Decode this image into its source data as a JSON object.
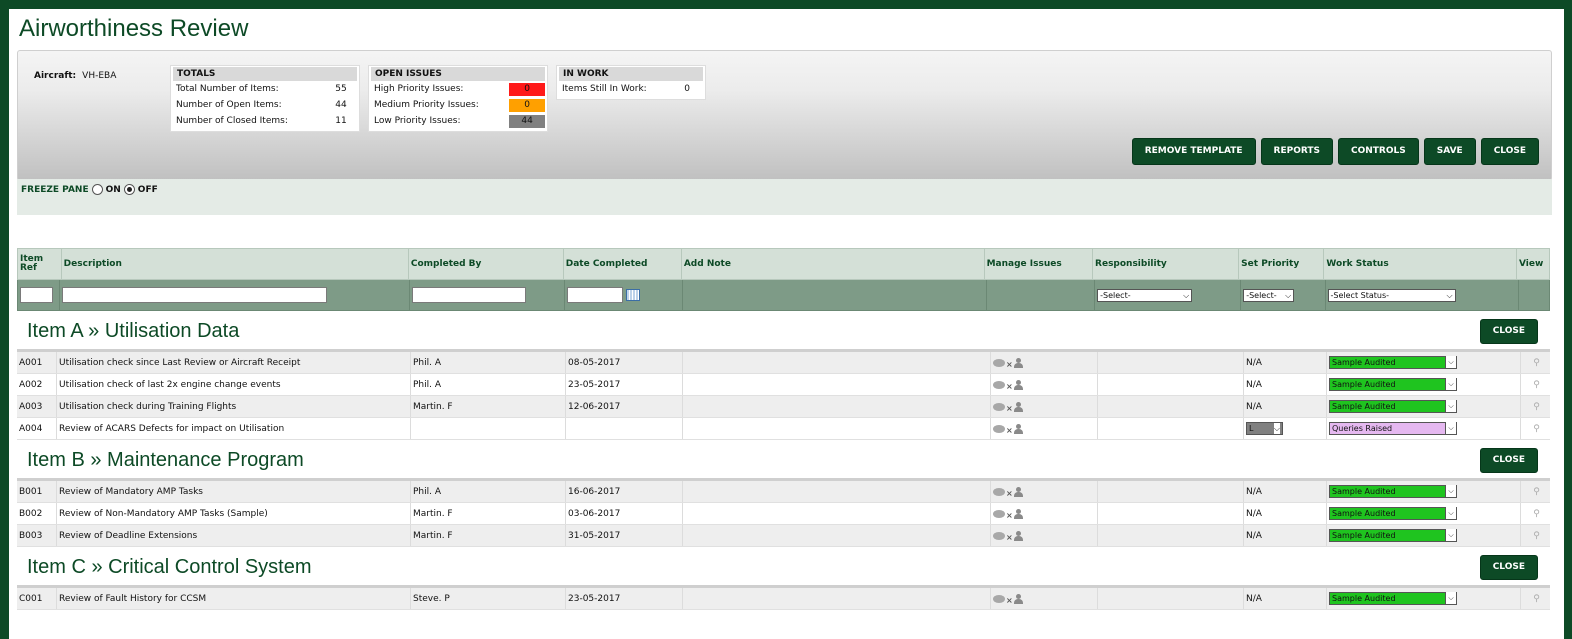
{
  "app": {
    "title": "Airworthiness Review"
  },
  "aircraft": {
    "label": "Aircraft:",
    "value": "VH-EBA"
  },
  "totals": {
    "heading": "TOTALS",
    "rows": [
      {
        "label": "Total Number of Items:",
        "value": "55"
      },
      {
        "label": "Number of Open Items:",
        "value": "44"
      },
      {
        "label": "Number of Closed Items:",
        "value": "11"
      }
    ]
  },
  "open_issues": {
    "heading": "OPEN ISSUES",
    "rows": [
      {
        "label": "High Priority Issues:",
        "value": "0",
        "color": "#ff1a1a"
      },
      {
        "label": "Medium Priority Issues:",
        "value": "0",
        "color": "#ffa000"
      },
      {
        "label": "Low Priority Issues:",
        "value": "44",
        "color": "#808080"
      }
    ]
  },
  "in_work": {
    "heading": "IN WORK",
    "rows": [
      {
        "label": "Items Still In Work:",
        "value": "0"
      }
    ]
  },
  "toolbar": {
    "remove_template": "REMOVE TEMPLATE",
    "reports": "REPORTS",
    "controls": "CONTROLS",
    "save": "SAVE",
    "close": "CLOSE"
  },
  "freeze": {
    "label": "FREEZE PANE",
    "on": "ON",
    "off": "OFF",
    "selected": "OFF"
  },
  "columns": {
    "ref": "Item Ref",
    "description": "Description",
    "completed_by": "Completed By",
    "date_completed": "Date Completed",
    "add_note": "Add Note",
    "manage_issues": "Manage Issues",
    "responsibility": "Responsibility",
    "set_priority": "Set Priority",
    "work_status": "Work Status",
    "view": "View"
  },
  "filters": {
    "responsibility": "-Select-",
    "priority": "-Select-",
    "status": "-Select Status-"
  },
  "colors": {
    "brand": "#0d4a26",
    "audited": "#1fc41f",
    "queries": "#e5b8f0"
  },
  "sections": [
    {
      "title": "Item A » Utilisation Data",
      "close_label": "CLOSE",
      "rows": [
        {
          "ref": "A001",
          "desc": "Utilisation check since Last Review or Aircraft Receipt",
          "by": "Phil. A",
          "date": "08-05-2017",
          "priority": "N/A",
          "status": "Sample Audited"
        },
        {
          "ref": "A002",
          "desc": "Utilisation check of last 2x engine change events",
          "by": "Phil. A",
          "date": "23-05-2017",
          "priority": "N/A",
          "status": "Sample Audited"
        },
        {
          "ref": "A003",
          "desc": "Utilisation check during Training Flights",
          "by": "Martin. F",
          "date": "12-06-2017",
          "priority": "N/A",
          "status": "Sample Audited"
        },
        {
          "ref": "A004",
          "desc": "Review of ACARS Defects for impact on Utilisation",
          "by": "",
          "date": "",
          "priority": "L",
          "status": "Queries Raised"
        }
      ]
    },
    {
      "title": "Item B » Maintenance Program",
      "close_label": "CLOSE",
      "rows": [
        {
          "ref": "B001",
          "desc": "Review of Mandatory AMP Tasks",
          "by": "Phil. A",
          "date": "16-06-2017",
          "priority": "N/A",
          "status": "Sample Audited"
        },
        {
          "ref": "B002",
          "desc": "Review of Non-Mandatory AMP Tasks (Sample)",
          "by": "Martin. F",
          "date": "03-06-2017",
          "priority": "N/A",
          "status": "Sample Audited"
        },
        {
          "ref": "B003",
          "desc": "Review of Deadline Extensions",
          "by": "Martin. F",
          "date": "31-05-2017",
          "priority": "N/A",
          "status": "Sample Audited"
        }
      ]
    },
    {
      "title": "Item C » Critical Control System",
      "close_label": "CLOSE",
      "rows": [
        {
          "ref": "C001",
          "desc": "Review of Fault History for CCSM",
          "by": "Steve. P",
          "date": "23-05-2017",
          "priority": "N/A",
          "status": "Sample Audited"
        }
      ]
    }
  ]
}
